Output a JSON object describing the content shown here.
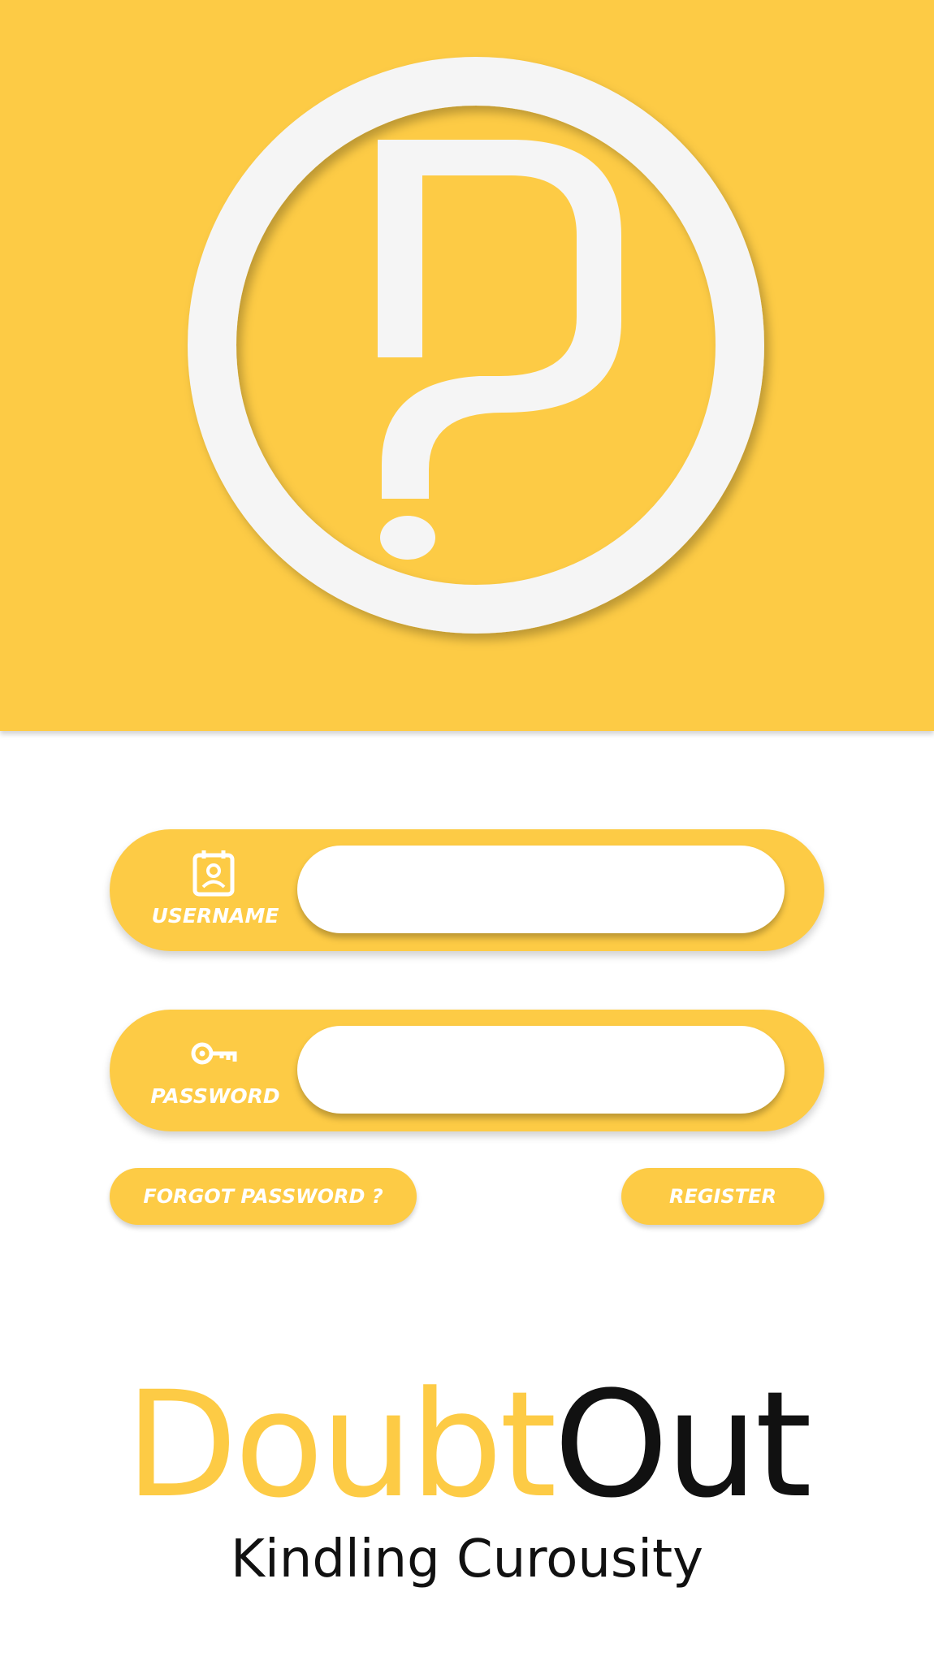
{
  "colors": {
    "accent": "#FDCB45",
    "surface": "#ffffff",
    "logo_stroke": "#F5F5F5",
    "text_dark": "#111111"
  },
  "header": {
    "logo_icon": "question-mark-circle-logo"
  },
  "login": {
    "username": {
      "label": "USERNAME",
      "icon": "user-badge-icon",
      "value": ""
    },
    "password": {
      "label": "PASSWORD",
      "icon": "key-icon",
      "value": ""
    }
  },
  "actions": {
    "forgot_label": "FORGOT PASSWORD ?",
    "register_label": "REGISTER"
  },
  "brand": {
    "name_part1": "Doubt",
    "name_part2": "Out",
    "tagline": "Kindling Curousity"
  }
}
